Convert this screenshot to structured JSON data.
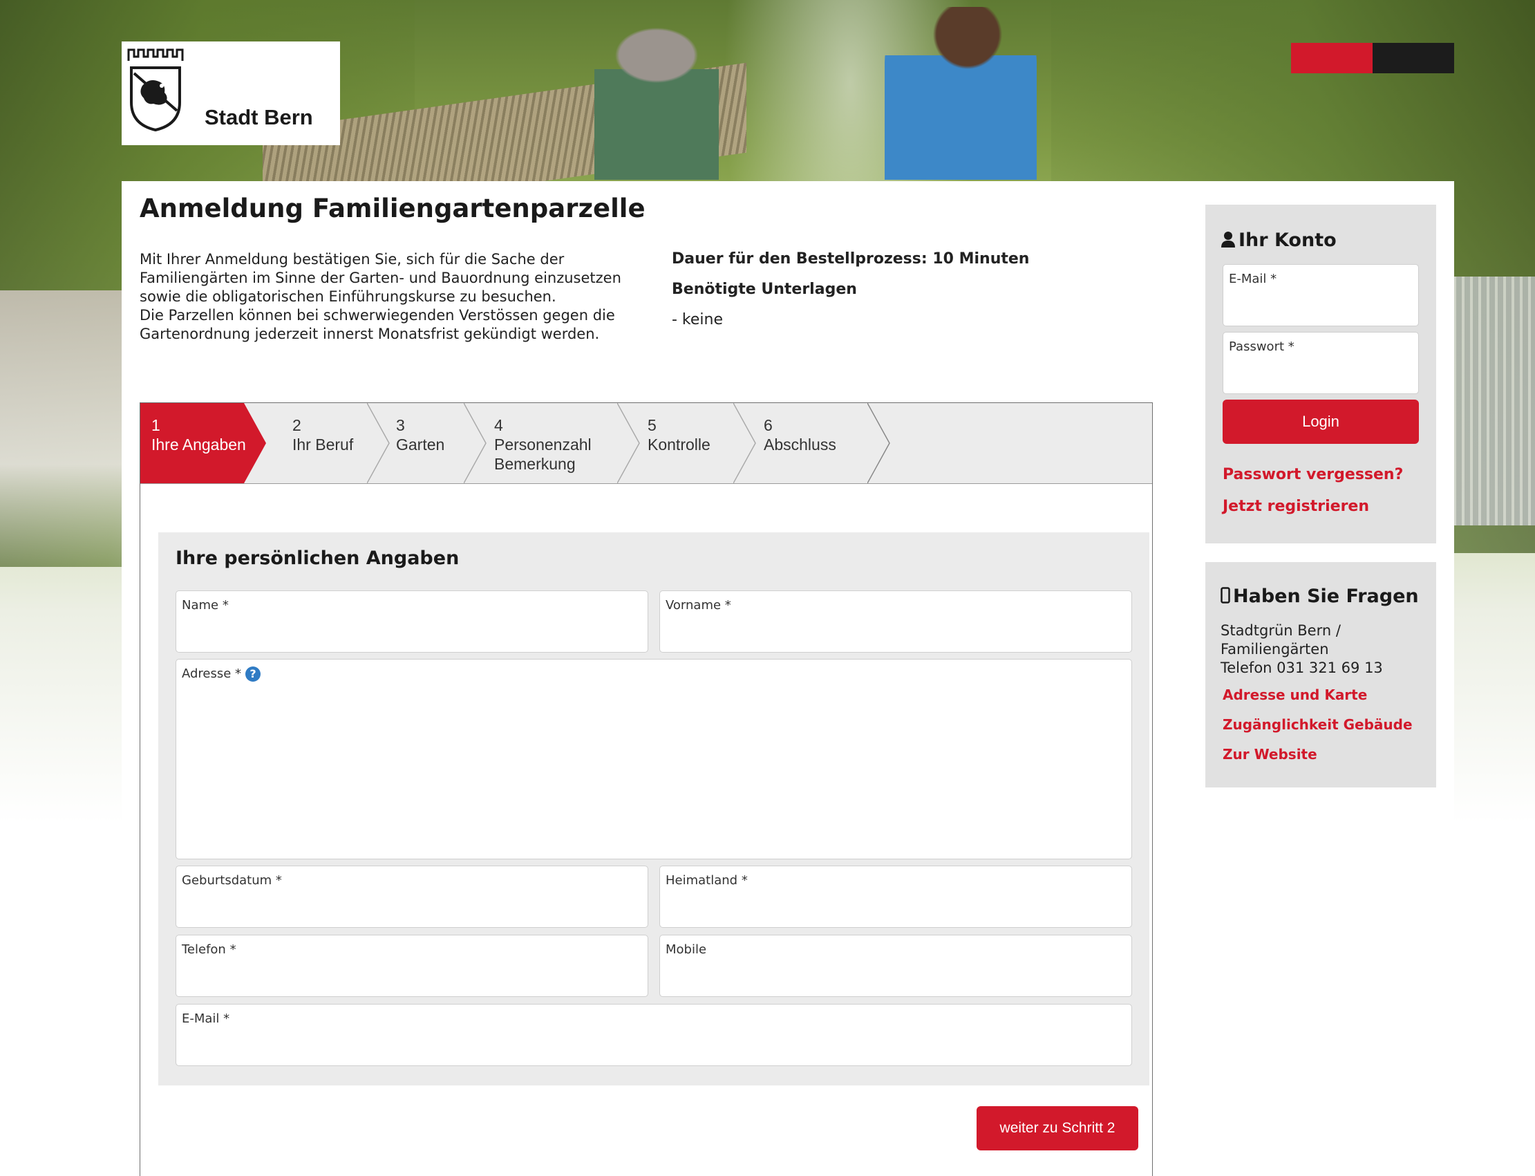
{
  "header": {
    "logo_text": "Stadt Bern"
  },
  "page": {
    "title": "Anmeldung Familiengartenparzelle",
    "intro_1": "Mit Ihrer Anmeldung bestätigen Sie, sich für die Sache der Familiengärten im Sinne der Garten- und Bauordnung einzusetzen sowie die obligatorischen Einführungskurse zu besuchen.",
    "intro_2": "Die Parzellen können bei schwerwiegenden Verstössen gegen die Gartenordnung jederzeit innerst Monatsfrist gekündigt werden.",
    "duration": "Dauer für den Bestellprozess: 10 Minuten",
    "documents_label": "Benötigte Unterlagen",
    "documents_value": "- keine"
  },
  "steps": [
    {
      "num": "1",
      "label": "Ihre Angaben",
      "label2": ""
    },
    {
      "num": "2",
      "label": "Ihr Beruf",
      "label2": ""
    },
    {
      "num": "3",
      "label": "Garten",
      "label2": ""
    },
    {
      "num": "4",
      "label": "Personenzahl",
      "label2": "Bemerkung"
    },
    {
      "num": "5",
      "label": "Kontrolle",
      "label2": ""
    },
    {
      "num": "6",
      "label": "Abschluss",
      "label2": ""
    }
  ],
  "form": {
    "title": "Ihre persönlichen Angaben",
    "name_label": "Name *",
    "vorname_label": "Vorname *",
    "adresse_label": "Adresse *",
    "geburtsdatum_label": "Geburtsdatum *",
    "heimatland_label": "Heimatland *",
    "telefon_label": "Telefon *",
    "mobile_label": "Mobile",
    "email_label": "E-Mail *",
    "next_button": "weiter zu Schritt 2"
  },
  "account": {
    "title": "Ihr Konto",
    "email_label": "E-Mail *",
    "password_label": "Passwort *",
    "login_button": "Login",
    "forgot_link": "Passwort vergessen?",
    "register_link": "Jetzt registrieren"
  },
  "questions": {
    "title": "Haben Sie Fragen",
    "contact_line1": "Stadtgrün Bern /",
    "contact_line2": "Familiengärten",
    "contact_line3": "Telefon 031 321 69 13",
    "link_address": "Adresse und Karte",
    "link_access": "Zugänglichkeit Gebäude",
    "link_website": "Zur Website"
  },
  "colors": {
    "accent": "#d2192b",
    "panel_bg": "#e1e1e1",
    "form_bg": "#ebebeb",
    "help_icon": "#2f7bc4"
  },
  "icons": {
    "account": "user-icon",
    "questions": "phone-icon",
    "help": "help-icon",
    "logo": "bern-bear-shield-icon"
  }
}
